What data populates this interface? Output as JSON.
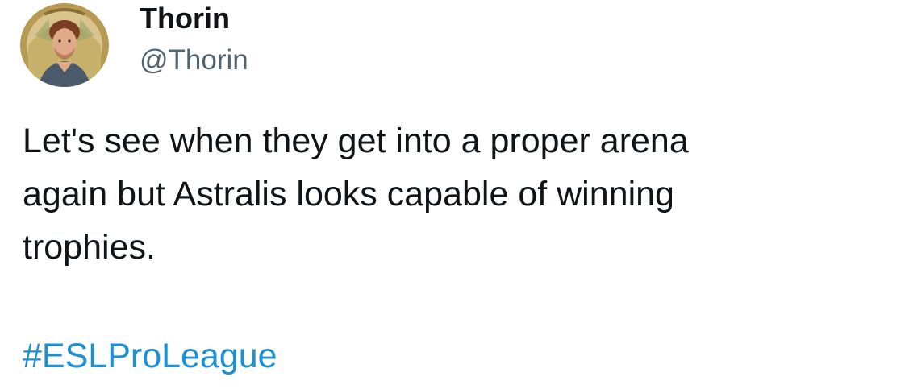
{
  "author": {
    "display_name": "Thorin",
    "handle": "@Thorin",
    "avatar": "profile-photo"
  },
  "tweet": {
    "text": "Let's see when they get into a proper arena\nagain but Astralis looks capable of winning\ntrophies.",
    "hashtag": "#ESLProLeague"
  },
  "colors": {
    "text": "#0f1419",
    "handle": "#536471",
    "link": "#1d8fd2"
  }
}
